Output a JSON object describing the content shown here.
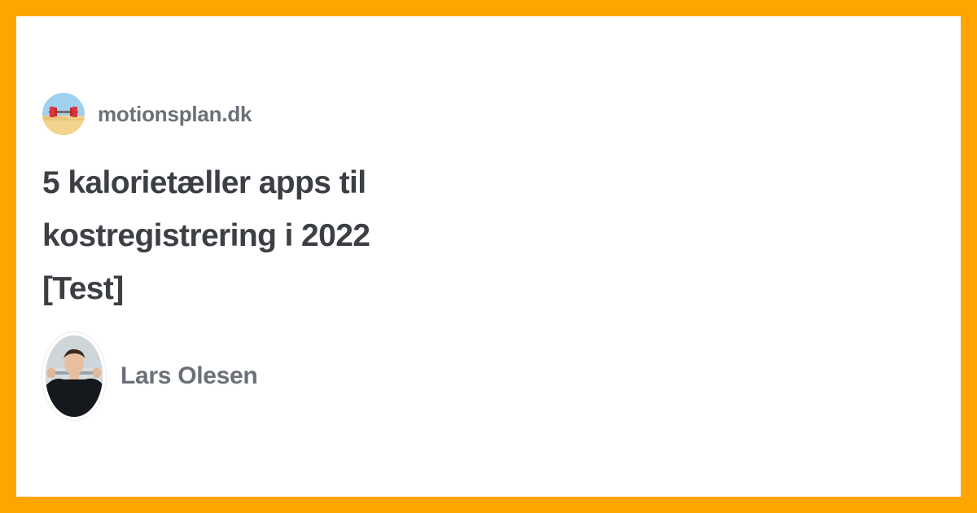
{
  "site": {
    "name": "motionsplan.dk",
    "logo_icon": "barbell-beach-logo-icon"
  },
  "article": {
    "title_lines": [
      "5 kalorietæller apps til",
      "kostregistrering i 2022",
      "[Test]"
    ]
  },
  "author": {
    "name": "Lars Olesen",
    "avatar_icon": "author-photo-avatar"
  },
  "colors": {
    "frame": "#ffa500",
    "card": "#ffffff",
    "title": "#3c3f44",
    "meta_text": "#6b7078"
  }
}
